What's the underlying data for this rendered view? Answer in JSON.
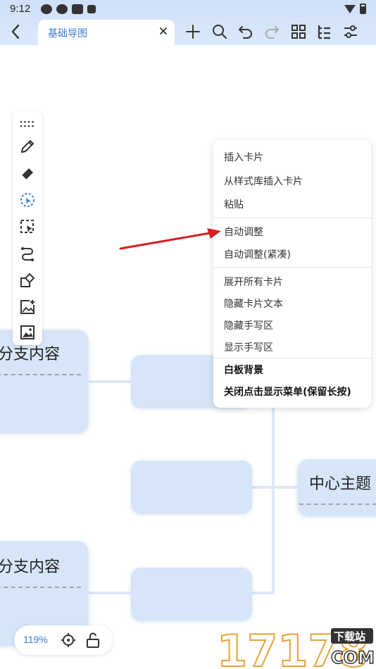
{
  "status_bar": {
    "time": "9:12",
    "icons": [
      "settings-app-icon",
      "settings-app-icon",
      "square-app-icon",
      "a-app-icon"
    ],
    "right_icons": [
      "wifi-icon",
      "battery-icon"
    ]
  },
  "toolbar": {
    "back_icon": "back-arrow-icon",
    "tab_title": "基础导图",
    "tab_close_icon": "close-icon",
    "tools": [
      "add-icon",
      "search-icon",
      "undo-icon",
      "redo-icon",
      "grid-icon",
      "outline-icon",
      "settings-sliders-icon"
    ]
  },
  "side_tools": [
    "drag-handle-icon",
    "pen-icon",
    "eraser-icon",
    "lasso-select-icon",
    "box-select-icon",
    "connector-icon",
    "shape-icon",
    "add-image-icon",
    "image-icon"
  ],
  "canvas": {
    "nodes": [
      {
        "id": "branch-top",
        "text": "分支内容"
      },
      {
        "id": "branch-bottom",
        "text": "分支内容"
      },
      {
        "id": "center",
        "text": "中心主题"
      }
    ]
  },
  "context_menu": {
    "groups": [
      [
        "插入卡片",
        "从样式库插入卡片",
        "粘贴"
      ],
      [
        "自动调整",
        "自动调整(紧凑)"
      ],
      [
        "展开所有卡片",
        "隐藏卡片文本",
        "隐藏手写区",
        "显示手写区"
      ],
      [
        "白板背景",
        "关闭点击显示菜单(保留长按)"
      ]
    ]
  },
  "zoom": {
    "level": "119%",
    "locate_icon": "crosshair-icon",
    "lock_icon": "unlock-icon"
  },
  "watermark": {
    "brand": "17178",
    "tag": "下载站",
    "suffix": "COM"
  },
  "colors": {
    "accent": "#3a7bd5",
    "node_fill": "#d6e6f8",
    "arrow": "#d42020",
    "toolbar_bg": "#cfe0f8"
  }
}
